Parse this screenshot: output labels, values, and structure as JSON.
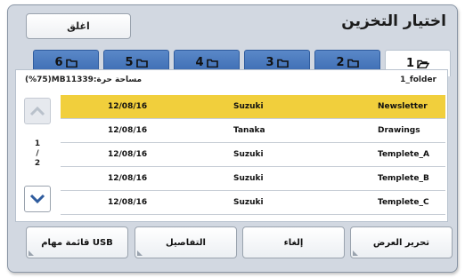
{
  "dialog": {
    "title": "اختيار التخزين",
    "close_label": "اغلق"
  },
  "tabs": [
    {
      "label": "1",
      "active": true
    },
    {
      "label": "2",
      "active": false
    },
    {
      "label": "3",
      "active": false
    },
    {
      "label": "4",
      "active": false
    },
    {
      "label": "5",
      "active": false
    },
    {
      "label": "6",
      "active": false
    }
  ],
  "storage": {
    "free_space": "(%75)MB11339:مساحة حرة",
    "folder_name": "1_folder"
  },
  "pager": {
    "current": "1",
    "separator": "/",
    "total": "2"
  },
  "files": [
    {
      "name": "Newsletter",
      "owner": "Suzuki",
      "date": "12/08/16",
      "selected": true
    },
    {
      "name": "Drawings",
      "owner": "Tanaka",
      "date": "12/08/16",
      "selected": false
    },
    {
      "name": "Templete_A",
      "owner": "Suzuki",
      "date": "12/08/16",
      "selected": false
    },
    {
      "name": "Templete_B",
      "owner": "Suzuki",
      "date": "12/08/16",
      "selected": false
    },
    {
      "name": "Templete_C",
      "owner": "Suzuki",
      "date": "12/08/16",
      "selected": false
    }
  ],
  "actions": {
    "edit_view": "تحرير العرض",
    "cancel": "إلغاء",
    "details": "التفاصيل",
    "usb_jobs": "قائمة مهام USB"
  },
  "colors": {
    "tab_blue": "#3a6ab1",
    "selected_row": "#f1cf3c",
    "frame": "#d2d8e1"
  }
}
